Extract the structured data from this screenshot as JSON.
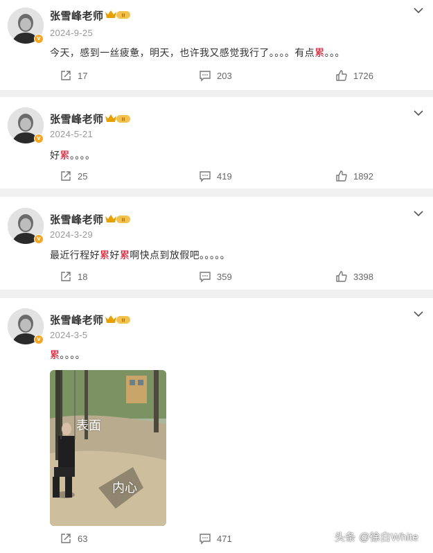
{
  "posts": [
    {
      "author": "张雪峰老师",
      "date": "2024-9-25",
      "text_before": "今天，感到一丝疲惫，明天，也许我又感觉我行了。。。。有点",
      "text_highlight": "累",
      "text_after": "。。。",
      "shares": "17",
      "comments": "203",
      "likes": "1726"
    },
    {
      "author": "张雪峰老师",
      "date": "2024-5-21",
      "text_before": "好",
      "text_highlight": "累",
      "text_after": "。。。。",
      "shares": "25",
      "comments": "419",
      "likes": "1892"
    },
    {
      "author": "张雪峰老师",
      "date": "2024-3-29",
      "text_before": "最近行程好",
      "text_highlight": "累",
      "text_mid": "好",
      "text_highlight2": "累",
      "text_after": "啊快点到放假吧。。。。。",
      "shares": "18",
      "comments": "359",
      "likes": "3398"
    },
    {
      "author": "张雪峰老师",
      "date": "2024-3-5",
      "text_before": "",
      "text_highlight": "累",
      "text_after": "。。。。",
      "image_label_top": "表面",
      "image_label_bottom": "内心",
      "shares": "63",
      "comments": "471"
    }
  ],
  "watermark": "头条 @徐白White",
  "icons": {
    "share": "share-icon",
    "comment": "comment-icon",
    "like": "like-icon",
    "more": "chevron-down-icon",
    "verified": "verified-badge-icon",
    "vip": "crown-badge-icon"
  },
  "colors": {
    "highlight": "#d0021b",
    "verified": "#f5a623",
    "crown": "#e6a100"
  }
}
